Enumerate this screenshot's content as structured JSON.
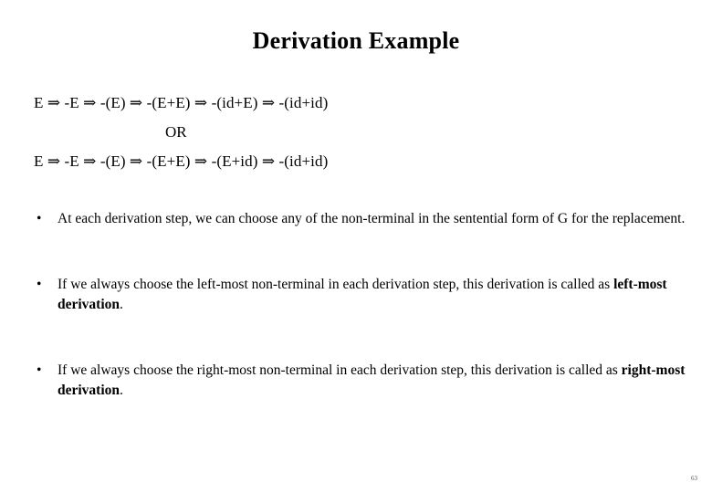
{
  "slide": {
    "title": "Derivation Example",
    "page_number": "63"
  },
  "derivations": {
    "left_most": "E ⇒ -E ⇒ -(E) ⇒ -(E+E) ⇒ -(id+E) ⇒ -(id+id)",
    "separator": "OR",
    "right_most": "E ⇒ -E ⇒ -(E) ⇒ -(E+E) ⇒ -(E+id) ⇒ -(id+id)"
  },
  "bullets": [
    {
      "marker": "•",
      "text_before": "At each derivation step, we can choose any of the non-terminal in the sentential form of G for the replacement.",
      "emphasis": "",
      "text_after": ""
    },
    {
      "marker": "•",
      "text_before": "If we always choose the left-most non-terminal in each derivation step, this derivation is called as ",
      "emphasis": "left-most derivation",
      "text_after": "."
    },
    {
      "marker": "•",
      "text_before": "If we always choose the right-most non-terminal in each derivation step, this derivation is called as ",
      "emphasis": "right-most derivation",
      "text_after": "."
    }
  ]
}
